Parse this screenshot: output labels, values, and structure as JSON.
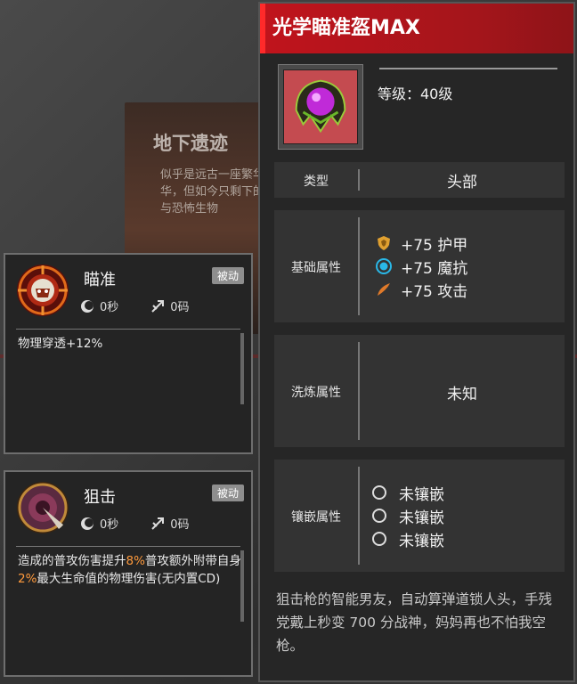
{
  "background": {
    "card_title": "地下遗迹",
    "card_text": "似乎是远古一座繁华世繁华，但如今只剩下的怪物与恐怖生物"
  },
  "skills": [
    {
      "name": "瞄准",
      "badge": "被动",
      "cooldown": "0秒",
      "cost": "0码",
      "desc_parts": [
        "物理穿透+12%"
      ]
    },
    {
      "name": "狙击",
      "badge": "被动",
      "cooldown": "0秒",
      "cost": "0码",
      "desc_parts": [
        "造成的普攻伤害提升",
        "8%",
        "普攻额外附带自身",
        "2%",
        "最大生命值的物理伤害(无内置CD)"
      ]
    }
  ],
  "item": {
    "name": "光学瞄准盔MAX",
    "level": "等级：40级",
    "type_label": "类型",
    "type_value": "头部",
    "base_label": "基础属性",
    "base_stats": [
      {
        "text": "+75 护甲",
        "icon": "armor-shield-icon"
      },
      {
        "text": "+75 魔抗",
        "icon": "magic-resist-icon"
      },
      {
        "text": "+75 攻击",
        "icon": "attack-icon"
      }
    ],
    "wash_label": "洗炼属性",
    "wash_value": "未知",
    "gem_label": "镶嵌属性",
    "gems": [
      "未镶嵌",
      "未镶嵌",
      "未镶嵌"
    ],
    "description": "狙击枪的智能男友，自动算弹道锁人头，手残党戴上秒变 700 分战神，妈妈再也不怕我空枪。"
  },
  "colors": {
    "title_red": "#c0141c",
    "highlight_orange": "#ff9a3c",
    "magic_cyan": "#2ab8e8",
    "armor_gold": "#e0a030",
    "attack_orange": "#e07a2a"
  }
}
